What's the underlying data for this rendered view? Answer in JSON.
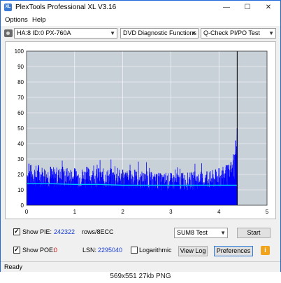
{
  "window": {
    "title": "PlexTools Professional XL V3.16",
    "minimize_glyph": "—",
    "maximize_glyph": "☐",
    "close_glyph": "✕"
  },
  "menu": {
    "options": "Options",
    "help": "Help"
  },
  "toolbar": {
    "drive": "HA:8 ID:0  PX-760A",
    "function": "DVD Diagnostic Functions",
    "test": "Q-Check PI/PO Test"
  },
  "chart_data": {
    "type": "bar",
    "xlabel": "",
    "ylabel": "",
    "xlim": [
      0,
      5
    ],
    "ylim": [
      0,
      100
    ],
    "x_ticks": [
      "0",
      "1",
      "2",
      "3",
      "4",
      "5"
    ],
    "y_ticks": [
      "0",
      "10",
      "20",
      "30",
      "40",
      "50",
      "60",
      "70",
      "80",
      "90",
      "100"
    ],
    "grid": true,
    "data_end_x": 4.38,
    "plot_background": "#c8d0d8",
    "bar_color": "#0000ff",
    "line_color": "#00c8ff",
    "series": [
      {
        "type": "bar",
        "x": [
          0.05,
          0.25,
          0.5,
          0.75,
          1.0,
          1.25,
          1.5,
          1.75,
          2.0,
          2.25,
          2.5,
          2.75,
          3.0,
          3.25,
          3.5,
          3.75,
          4.0,
          4.15,
          4.25,
          4.3,
          4.35,
          4.38
        ],
        "values": [
          27,
          26,
          25,
          25,
          24,
          25,
          24,
          24,
          23,
          23,
          22,
          21,
          21,
          21,
          22,
          22,
          24,
          26,
          28,
          33,
          42,
          50
        ]
      },
      {
        "type": "line",
        "x": [
          0,
          0.5,
          1,
          1.5,
          2,
          2.5,
          3,
          3.5,
          4,
          4.38
        ],
        "values": [
          14,
          14,
          13.5,
          13.5,
          13,
          13,
          13,
          13,
          13,
          13
        ]
      }
    ]
  },
  "controls": {
    "show_pie_label": "Show PIE:",
    "pie_value": "242322",
    "pie_units": "rows/8ECC",
    "show_poe_label": "Show POE:",
    "poe_value": "0",
    "lsn_label": "LSN:",
    "lsn_value": "2295040",
    "logarithmic_label": "Logarithmic",
    "test_select": "SUM8 Test",
    "start_button": "Start",
    "view_log_button": "View Log",
    "preferences_button": "Preferences",
    "info_glyph": "i"
  },
  "status": {
    "text": "Ready"
  },
  "footer": {
    "caption": "569x551  27kb  PNG"
  }
}
